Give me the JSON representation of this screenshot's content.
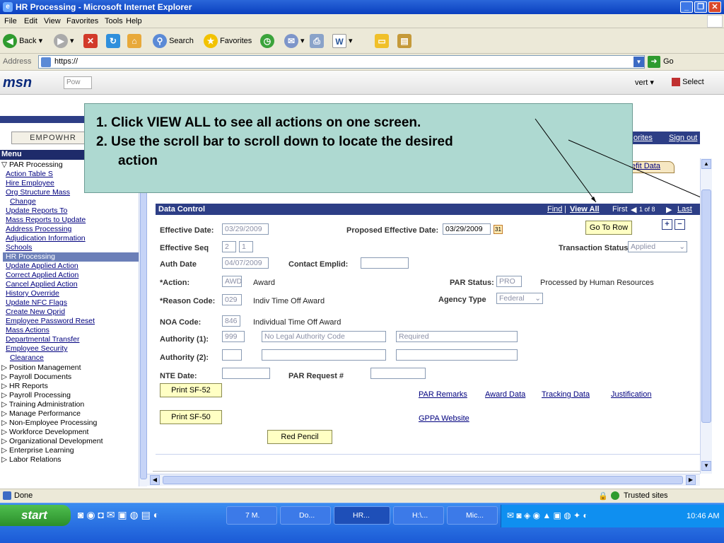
{
  "window": {
    "title": "HR Processing - Microsoft Internet Explorer"
  },
  "menubar": [
    "File",
    "Edit",
    "View",
    "Favorites",
    "Tools",
    "Help"
  ],
  "toolbar": {
    "back": "Back",
    "search": "Search",
    "favorites": "Favorites"
  },
  "address": {
    "label": "Address",
    "url": "https://",
    "go": "Go"
  },
  "msn": {
    "logo": "msn",
    "search_placeholder": "Pow",
    "convert": "vert",
    "select": "Select"
  },
  "sidebar": {
    "menu_title": "Menu",
    "root": "PAR Processing",
    "items": [
      "Action Table S",
      "Hire Employee",
      "Org Structure Mass",
      "Change",
      "Update Reports To",
      "Mass Reports to Update",
      "Address Processing",
      "Adjudication Information",
      "Schools"
    ],
    "selected": "HR Processing",
    "items2": [
      "Update Applied Action",
      "Correct Applied Action",
      "Cancel Applied Action",
      "History Override",
      "Update NFC Flags",
      "Create New Oprid",
      "Employee Password Reset",
      "Mass Actions",
      "Departmental Transfer",
      "Employee Security",
      "Clearance"
    ],
    "categories": [
      "Position Management",
      "Payroll Documents",
      "HR Reports",
      "Payroll Processing",
      "Training Administration",
      "Manage Performance",
      "Non-Employee Processing",
      "Workforce Development",
      "Organizational Development",
      "Enterprise Learning",
      "Labor Relations"
    ]
  },
  "header_links": {
    "favorites": "orites",
    "signout": "Sign out",
    "tab": "efit Data"
  },
  "data_control": {
    "title": "Data Control",
    "find": "Find",
    "sep": "|",
    "view_all": "View All",
    "first": "First",
    "count": "1 of 8",
    "last": "Last",
    "effective_date_label": "Effective Date:",
    "effective_date": "03/29/2009",
    "proposed_label": "Proposed Effective Date:",
    "proposed_date": "03/29/2009",
    "go_to_row": "Go To Row",
    "effective_seq_label": "Effective Seq",
    "seq1": "2",
    "seq2": "1",
    "transaction_status_label": "Transaction Status",
    "transaction_status": "Applied",
    "auth_date_label": "Auth Date",
    "auth_date": "04/07/2009",
    "contact_label": "Contact Emplid:",
    "action_label": "*Action:",
    "action_code": "AWD",
    "action_text": "Award",
    "par_status_label": "PAR Status:",
    "par_status_code": "PRO",
    "par_status_text": "Processed by Human Resources",
    "reason_label": "*Reason Code:",
    "reason_code": "029",
    "reason_text": "Indiv Time Off Award",
    "agency_type_label": "Agency Type",
    "agency_type": "Federal",
    "noa_label": "NOA Code:",
    "noa_code": "846",
    "noa_text": "Individual Time Off Award",
    "authority1_label": "Authority (1):",
    "authority1_code": "999",
    "authority1_text": "No Legal Authority Code",
    "authority1_req": "Required",
    "authority2_label": "Authority (2):",
    "nte_label": "NTE Date:",
    "par_request_label": "PAR Request #",
    "print52": "Print SF-52",
    "print50": "Print SF-50",
    "red_pencil": "Red Pencil",
    "links": [
      "PAR Remarks",
      "Award Data",
      "Tracking Data",
      "Justification"
    ],
    "gppa": "GPPA Website"
  },
  "callout": {
    "line1": "1.  Click VIEW ALL  to see all actions on one screen.",
    "line2": "2.  Use the scroll bar to scroll down to locate the desired",
    "line3": "action"
  },
  "status": {
    "left": "Done",
    "zone": "Trusted sites"
  },
  "taskbar": {
    "start": "start",
    "tasks": [
      "7 M.",
      "Do...",
      "HR...",
      "H:\\...",
      "Mic..."
    ],
    "clock": "10:46 AM"
  }
}
